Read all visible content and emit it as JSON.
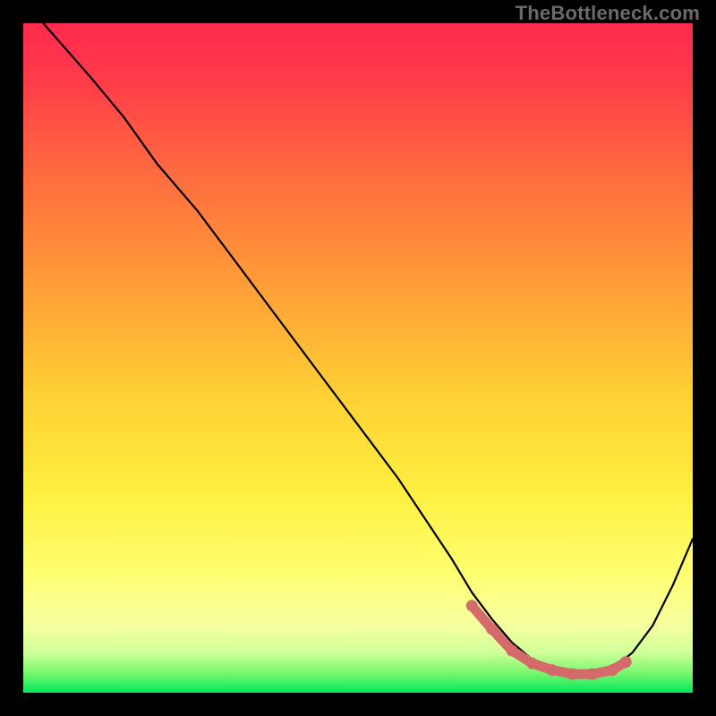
{
  "watermark": "TheBottleneck.com",
  "palette": {
    "gradient_top": "#ff2a4d",
    "gradient_mid1": "#ff8a3a",
    "gradient_mid2": "#ffdd33",
    "gradient_mid3": "#ffff78",
    "gradient_bottom": "#00e85a",
    "curve": "#000000",
    "marker": "#d46a6a",
    "frame": "#000000"
  },
  "chart_data": {
    "type": "line",
    "title": "",
    "xlabel": "",
    "ylabel": "",
    "xlim": [
      0,
      100
    ],
    "ylim": [
      0,
      100
    ],
    "grid": false,
    "legend": false,
    "series": [
      {
        "name": "curve",
        "x": [
          3,
          10,
          15,
          20,
          26,
          32,
          38,
          44,
          50,
          56,
          60,
          64,
          67,
          70,
          73,
          76,
          79,
          82,
          85,
          88,
          91,
          94,
          97,
          100
        ],
        "y": [
          100,
          92,
          86,
          79,
          72,
          64,
          56,
          48,
          40,
          32,
          26,
          20,
          15,
          11,
          7.5,
          5,
          3.4,
          2.8,
          2.8,
          3.6,
          6,
          10,
          16,
          23
        ]
      }
    ],
    "marker_region": {
      "name": "bottleneck-band",
      "x": [
        67,
        70,
        73,
        76,
        79,
        82,
        85,
        88,
        90
      ],
      "y": [
        13,
        9.5,
        6.3,
        4.4,
        3.4,
        2.8,
        2.8,
        3.4,
        4.6
      ]
    },
    "annotations": []
  }
}
